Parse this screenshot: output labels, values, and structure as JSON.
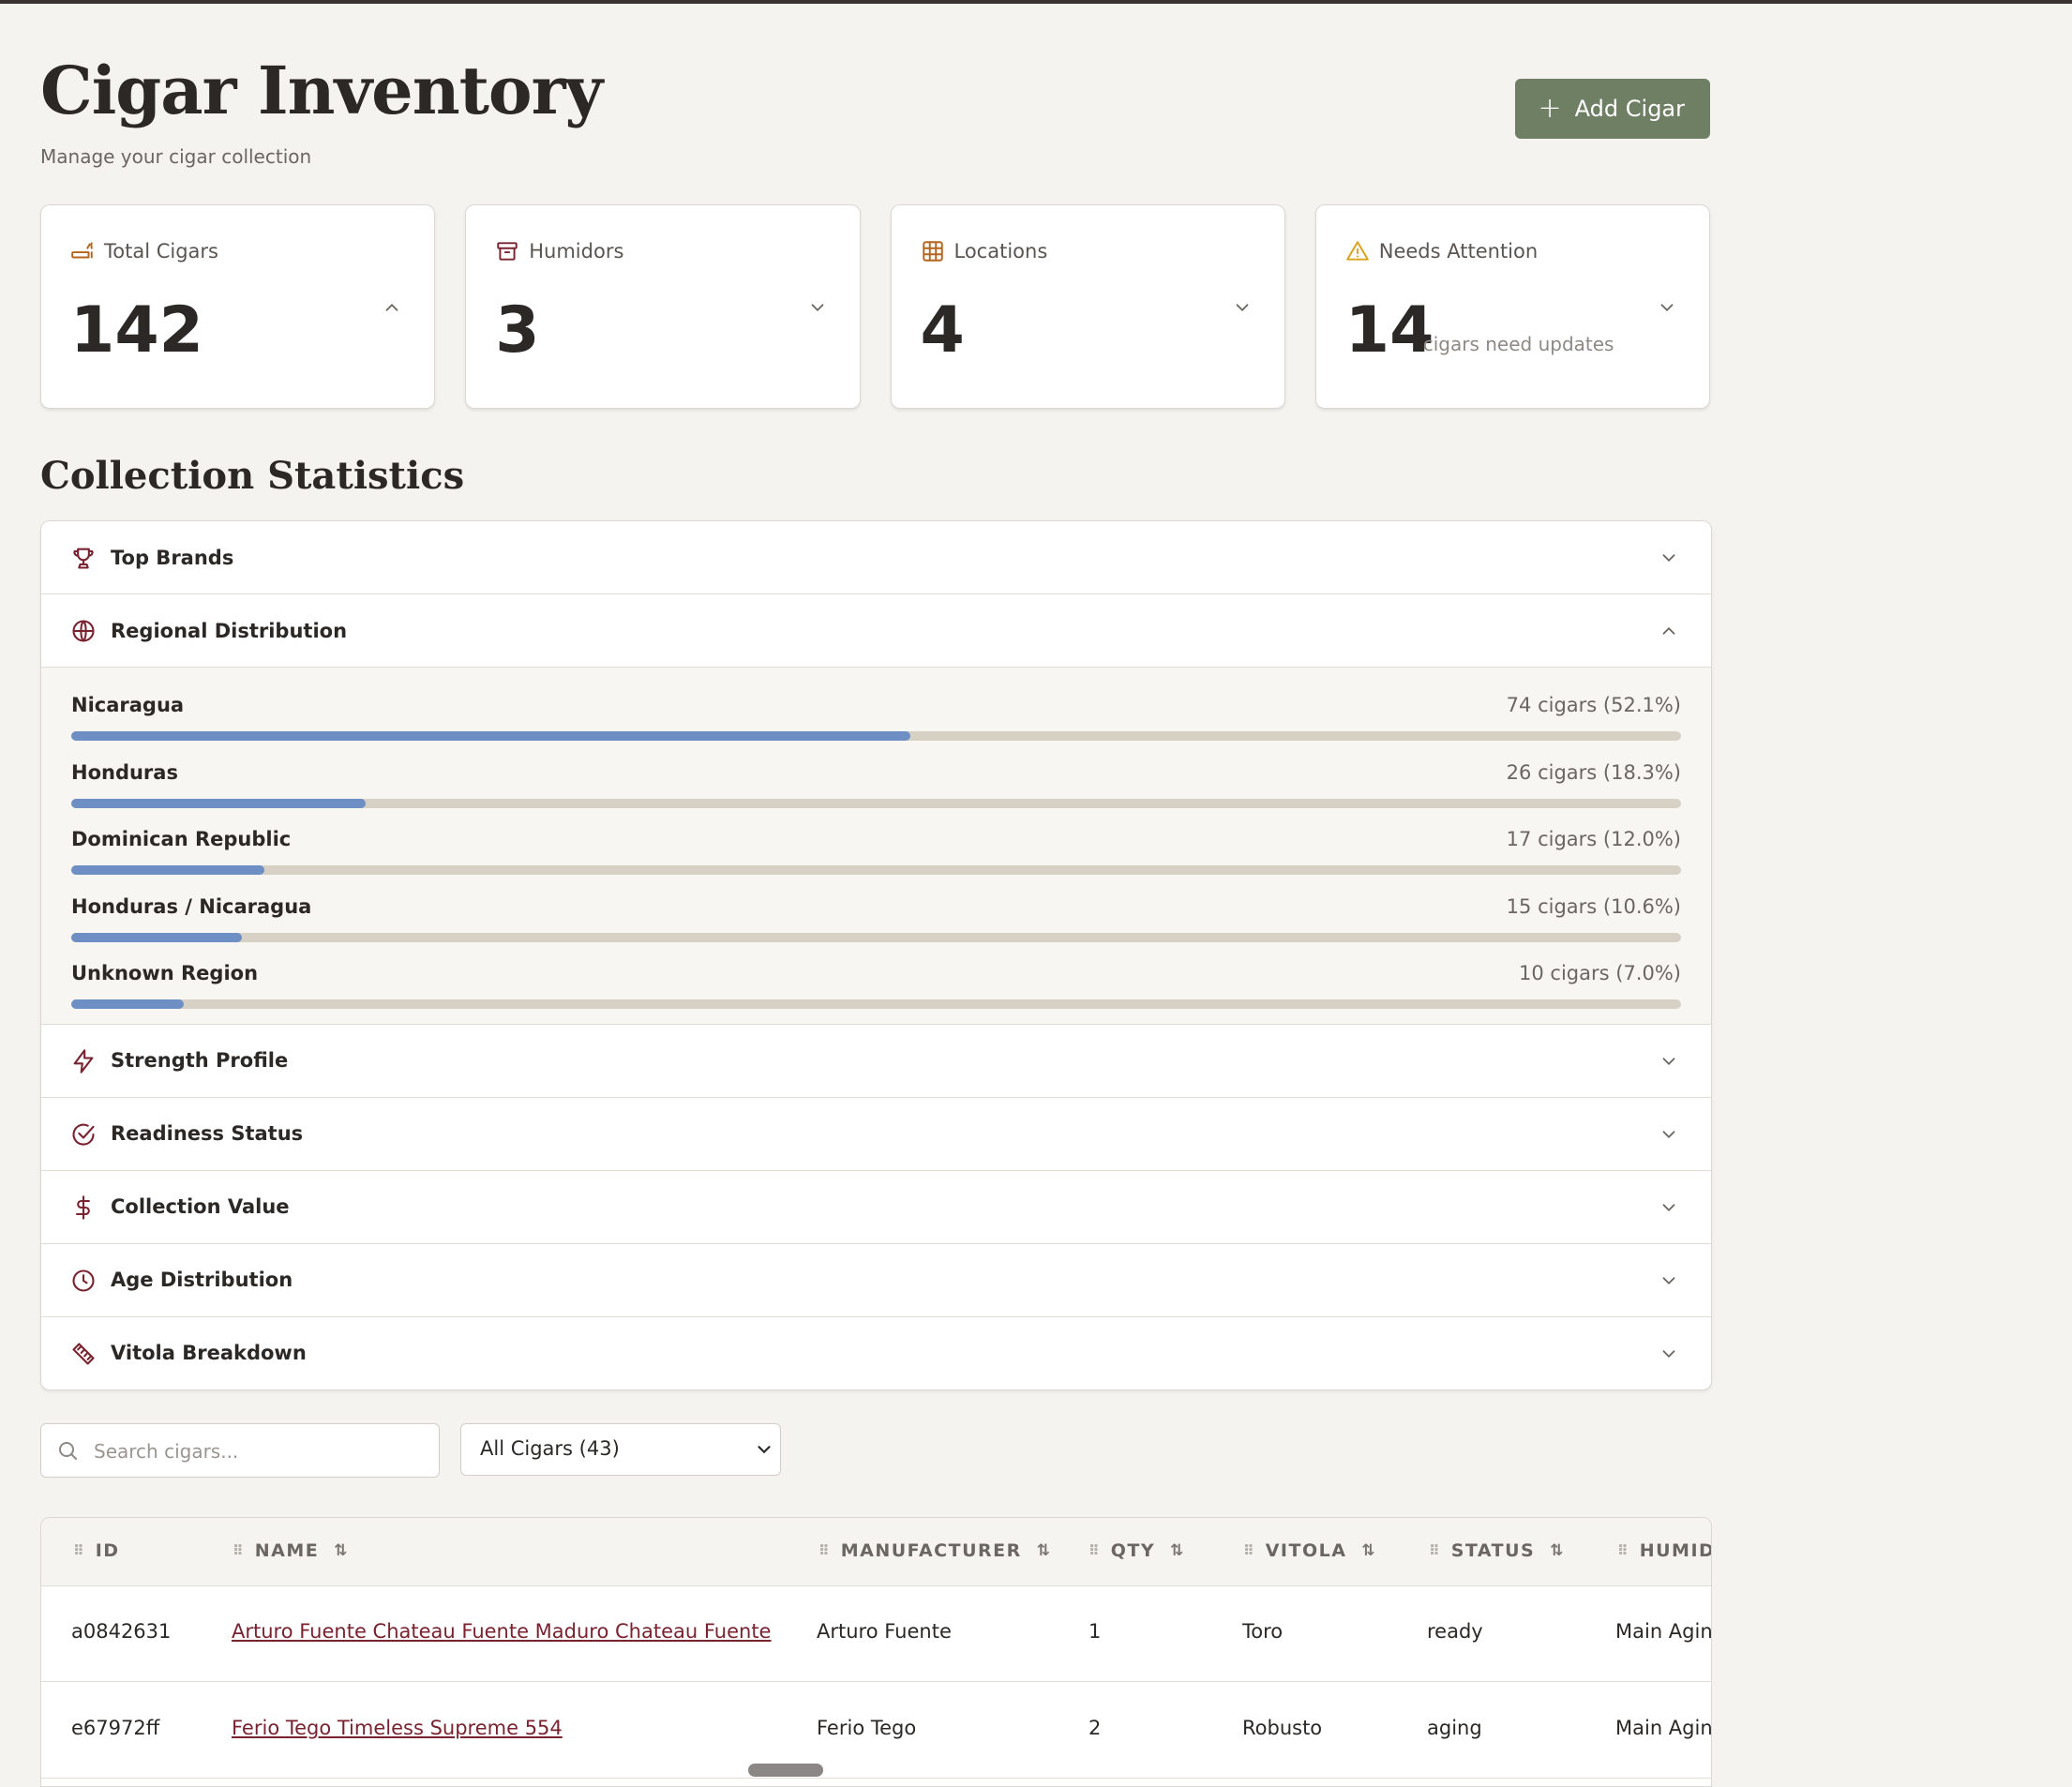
{
  "header": {
    "title": "Cigar Inventory",
    "subtitle": "Manage your cigar collection",
    "add_button": "Add Cigar"
  },
  "stats": [
    {
      "label": "Total Cigars",
      "value": "142",
      "sub": "",
      "icon": "cigar-icon",
      "expanded": true
    },
    {
      "label": "Humidors",
      "value": "3",
      "sub": "",
      "icon": "archive-box-icon",
      "expanded": false
    },
    {
      "label": "Locations",
      "value": "4",
      "sub": "",
      "icon": "grid-icon",
      "expanded": false
    },
    {
      "label": "Needs Attention",
      "value": "14",
      "sub": "cigars need updates",
      "icon": "warning-icon",
      "expanded": false
    }
  ],
  "statistics": {
    "title": "Collection Statistics",
    "sections": [
      {
        "label": "Top Brands",
        "icon": "trophy-icon",
        "expanded": false
      },
      {
        "label": "Regional Distribution",
        "icon": "globe-icon",
        "expanded": true
      },
      {
        "label": "Strength Profile",
        "icon": "lightning-icon",
        "expanded": false
      },
      {
        "label": "Readiness Status",
        "icon": "check-circle-icon",
        "expanded": false
      },
      {
        "label": "Collection Value",
        "icon": "dollar-icon",
        "expanded": false
      },
      {
        "label": "Age Distribution",
        "icon": "clock-icon",
        "expanded": false
      },
      {
        "label": "Vitola Breakdown",
        "icon": "ruler-icon",
        "expanded": false
      }
    ],
    "regions": [
      {
        "name": "Nicaragua",
        "count": "74 cigars (52.1%)",
        "percent": 52.1
      },
      {
        "name": "Honduras",
        "count": "26 cigars (18.3%)",
        "percent": 18.3
      },
      {
        "name": "Dominican Republic",
        "count": "17 cigars (12.0%)",
        "percent": 12.0
      },
      {
        "name": "Honduras / Nicaragua",
        "count": "15 cigars (10.6%)",
        "percent": 10.6
      },
      {
        "name": "Unknown Region",
        "count": "10 cigars (7.0%)",
        "percent": 7.0
      }
    ]
  },
  "filters": {
    "search_placeholder": "Search cigars...",
    "select_value": "All Cigars (43)"
  },
  "table": {
    "columns": [
      "ID",
      "NAME",
      "MANUFACTURER",
      "QTY",
      "VITOLA",
      "STATUS",
      "HUMIDO"
    ],
    "rows": [
      {
        "id": "a0842631",
        "name": "Arturo Fuente Chateau Fuente Maduro Chateau Fuente",
        "manufacturer": "Arturo Fuente",
        "qty": "1",
        "vitola": "Toro",
        "status": "ready",
        "humidor": "Main Agin"
      },
      {
        "id": "e67972ff",
        "name": "Ferio Tego Timeless Supreme 554",
        "manufacturer": "Ferio Tego",
        "qty": "2",
        "vitola": "Robusto",
        "status": "aging",
        "humidor": "Main Agin"
      }
    ]
  },
  "colors": {
    "accent_button": "#6f7f64",
    "link": "#7a2330",
    "bar_fill": "#6e8fc4",
    "bar_track": "#d6d0c5",
    "icon_warm": "#b5651d",
    "icon_warning": "#d9a21b",
    "icon_section": "#7a2330"
  }
}
